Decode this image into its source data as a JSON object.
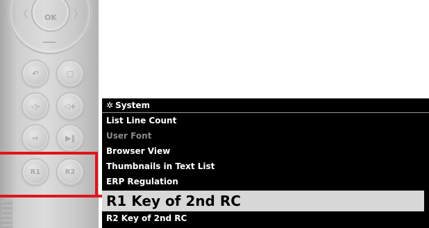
{
  "remote": {
    "ok_label": "OK",
    "left_arrow": "〈",
    "right_arrow": "〉",
    "buttons": [
      {
        "icon": "back-icon",
        "glyph": "↶"
      },
      {
        "icon": "stop-icon",
        "glyph": "□"
      },
      {
        "icon": "volume-down-icon",
        "glyph": "◁-"
      },
      {
        "icon": "volume-up-icon",
        "glyph": "◁+"
      },
      {
        "icon": "input-icon",
        "glyph": "⇨"
      },
      {
        "icon": "play-pause-icon",
        "glyph": "▶‖"
      },
      {
        "label": "R1"
      },
      {
        "label": "R2"
      }
    ]
  },
  "menu": {
    "header": "System",
    "items": [
      {
        "label": "List Line Count",
        "state": "normal"
      },
      {
        "label": "User Font",
        "state": "disabled"
      },
      {
        "label": "Browser View",
        "state": "normal"
      },
      {
        "label": "Thumbnails in Text List",
        "state": "normal"
      },
      {
        "label": "ERP Regulation",
        "state": "normal"
      },
      {
        "label": "R1 Key of 2nd RC",
        "state": "selected"
      },
      {
        "label": "R2 Key of 2nd RC",
        "state": "normal"
      }
    ]
  },
  "colors": {
    "highlight": "#e0141b",
    "menu_bg": "#000000",
    "selected_bg": "#d7d7d7"
  }
}
